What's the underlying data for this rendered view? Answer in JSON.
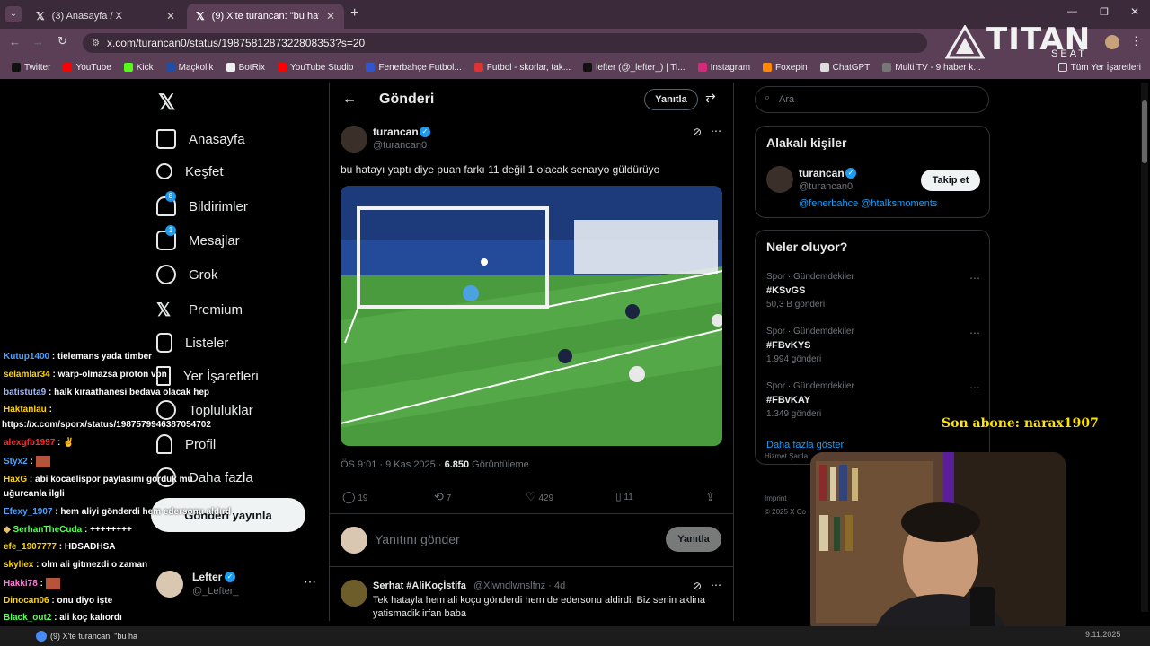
{
  "browser": {
    "tabs": [
      {
        "title": "(3) Anasayfa / X"
      },
      {
        "title": "(9) X'te turancan: \"bu hatayı ya"
      }
    ],
    "url": "x.com/turancan0/status/1987581287322808353?s=20",
    "bookmarks": [
      "Twitter",
      "YouTube",
      "Kick",
      "Maçkolik",
      "BotRix",
      "YouTube Studio",
      "Fenerbahçe Futbol...",
      "Futbol - skorlar, tak...",
      "lefter (@_lefter_) | Ti...",
      "Instagram",
      "Foxepin",
      "ChatGPT",
      "Multi TV - 9 haber k..."
    ],
    "all_bookmarks": "Tüm Yer İşaretleri"
  },
  "overlay": {
    "logo": "TITAN",
    "logo_sub": "SEAT",
    "subscriber": "Son abone: narax1907"
  },
  "nav": {
    "items": [
      "Anasayfa",
      "Keşfet",
      "Bildirimler",
      "Mesajlar",
      "Grok",
      "Premium",
      "Listeler",
      "Yer İşaretleri",
      "Topluluklar",
      "Profil",
      "Daha fazla"
    ],
    "notif_badge": "8",
    "msg_badge": "1",
    "post_button": "Gönderi yayınla",
    "user_name": "Lefter",
    "user_handle": "@_Lefter_"
  },
  "main": {
    "header_title": "Gönderi",
    "reply_button": "Yanıtla",
    "author_name": "turancan",
    "author_handle": "@turancan0",
    "tweet_text": "bu hatayı yaptı diye puan farkı 11 değil 1 olacak senaryo güldürüyo",
    "timestamp": "ÖS 9:01 · 9 Kas 2025 · ",
    "views": "6.850",
    "views_label": " Görüntüleme",
    "stats": {
      "replies": "19",
      "retweets": "7",
      "likes": "429",
      "bookmarks": "11"
    },
    "reply_placeholder": "Yanıtını gönder",
    "reply_submit": "Yanıtla",
    "reply1": {
      "name": "Serhat #AliKoçİstifa",
      "handle": "@Xlwndlwnslfnz · 4d",
      "text": "Tek hatayla hem ali koçu gönderdi hem de edersonu aldirdi. Biz senin aklina yatismadik irfan baba"
    }
  },
  "right": {
    "search_placeholder": "Ara",
    "related_title": "Alakalı kişiler",
    "related_name": "turancan",
    "related_handle": "@turancan0",
    "related_bio": "@fenerbahce @htalksmoments",
    "follow_button": "Takip et",
    "trends_title": "Neler oluyor?",
    "trends": [
      {
        "category": "Spor · Gündemdekiler",
        "name": "#KSvGS",
        "count": "50,3 B gönderi"
      },
      {
        "category": "Spor · Gündemdekiler",
        "name": "#FBvKYS",
        "count": "1.994 gönderi"
      },
      {
        "category": "Spor · Gündemdekiler",
        "name": "#FBvKAY",
        "count": "1.349 gönderi"
      }
    ],
    "show_more": "Daha fazla göster",
    "footer1": "Hizmet Şartla",
    "footer2": "Imprint",
    "footer3": "© 2025 X Co"
  },
  "chat": [
    {
      "user": "Kutup1400",
      "msg": "tielemans yada timber",
      "color": "#4aa3ff"
    },
    {
      "user": "selamlar34",
      "msg": "warp-olmazsa proton vpn",
      "color": "#ffd400"
    },
    {
      "user": "batistuta9",
      "msg": "halk kıraathanesi bedava olacak hep",
      "color": "#9db8ff"
    },
    {
      "user": "Haktanlau",
      "msg": "",
      "color": "#ffd400"
    },
    {
      "user": "",
      "msg": "https://x.com/sporx/status/1987579946387054702",
      "color": "#ffffff"
    },
    {
      "user": "alexgfb1997",
      "msg": "",
      "color": "#ff2d2d"
    },
    {
      "user": "Styx2",
      "msg": "",
      "color": "#4aa3ff"
    },
    {
      "user": "HaxG",
      "msg": "abi kocaelispor paylasımı gördük mü",
      "color": "#ffd400"
    },
    {
      "user": "",
      "msg": "uğurcanla ilgli",
      "color": "#ffffff"
    },
    {
      "user": "Efexy_1907",
      "msg": "hem aliyi gönderdi hem edersonu aldırd",
      "color": "#4aa3ff"
    },
    {
      "user": "SerhanTheCuda",
      "msg": "++++++++",
      "color": "#58ff58"
    },
    {
      "user": "efe_1907777",
      "msg": "HDSADHSA",
      "color": "#ffd400"
    },
    {
      "user": "skyliex",
      "msg": "olm ali gitmezdi o zaman",
      "color": "#ffd400"
    },
    {
      "user": "Hakki78",
      "msg": "",
      "color": "#ff7ad9"
    },
    {
      "user": "Dinocan06",
      "msg": "onu diyo işte",
      "color": "#ffd400"
    },
    {
      "user": "Black_out2",
      "msg": "ali koç kalıordı",
      "color": "#58ff58"
    }
  ],
  "taskbar": {
    "item": "(9) X'te turancan: \"bu ha",
    "date": "9.11.2025"
  }
}
